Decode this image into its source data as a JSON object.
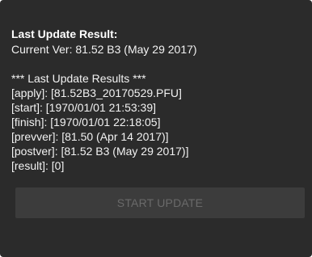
{
  "dialog": {
    "title": "Last Update Result:",
    "current_version": "Current Ver: 81.52 B3 (May 29 2017)"
  },
  "results": {
    "header": "*** Last Update Results ***",
    "lines": [
      "[apply]: [81.52B3_20170529.PFU]",
      "[start]: [1970/01/01 21:53:39]",
      "[finish]: [1970/01/01 22:18:05]",
      "[prevver]: [81.50 (Apr 14 2017)]",
      "[postver]: [81.52 B3 (May 29 2017)]",
      "[result]: [0]"
    ]
  },
  "actions": {
    "start_update_label": "START UPDATE",
    "start_update_enabled": false
  },
  "colors": {
    "background": "#2b2b2b",
    "text": "#f2f2f2",
    "button_bg": "#3c3c3c",
    "button_text_disabled": "#6a6a6a"
  }
}
